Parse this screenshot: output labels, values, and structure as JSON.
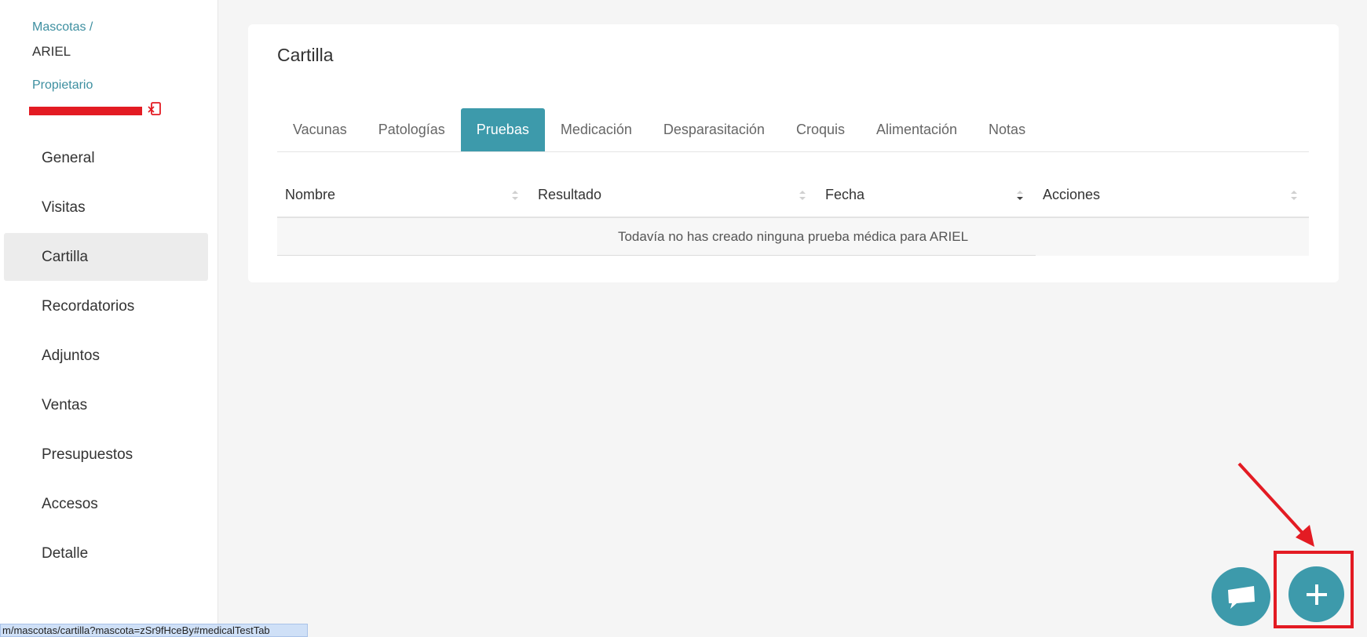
{
  "sidebar": {
    "breadcrumb": "Mascotas /",
    "pet_name": "ARIEL",
    "owner_label": "Propietario",
    "items": [
      {
        "label": "General"
      },
      {
        "label": "Visitas"
      },
      {
        "label": "Cartilla"
      },
      {
        "label": "Recordatorios"
      },
      {
        "label": "Adjuntos"
      },
      {
        "label": "Ventas"
      },
      {
        "label": "Presupuestos"
      },
      {
        "label": "Accesos"
      },
      {
        "label": "Detalle"
      }
    ],
    "active_item": "Cartilla"
  },
  "card": {
    "title": "Cartilla",
    "tabs": [
      {
        "label": "Vacunas"
      },
      {
        "label": "Patologías"
      },
      {
        "label": "Pruebas"
      },
      {
        "label": "Medicación"
      },
      {
        "label": "Desparasitación"
      },
      {
        "label": "Croquis"
      },
      {
        "label": "Alimentación"
      },
      {
        "label": "Notas"
      }
    ],
    "active_tab": "Pruebas",
    "table": {
      "columns": [
        {
          "label": "Nombre"
        },
        {
          "label": "Resultado"
        },
        {
          "label": "Fecha"
        },
        {
          "label": "Acciones"
        }
      ],
      "empty_message": "Todavía no has creado ninguna prueba médica para ARIEL"
    }
  },
  "statusbar": {
    "url": "m/mascotas/cartilla?mascota=zSr9fHceBy#medicalTestTab"
  },
  "colors": {
    "accent": "#3d9aab",
    "highlight": "#e31b23"
  }
}
